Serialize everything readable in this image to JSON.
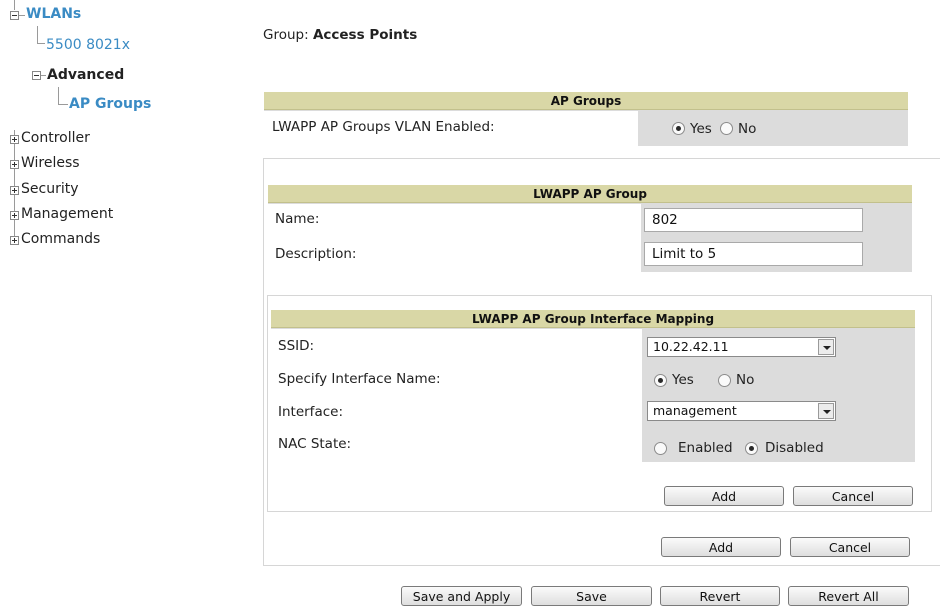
{
  "tree": {
    "wlans": "WLANs",
    "item_5500": "5500 8021x",
    "advanced": "Advanced",
    "ap_groups": "AP Groups",
    "controller": "Controller",
    "wireless": "Wireless",
    "security": "Security",
    "management": "Management",
    "commands": "Commands"
  },
  "group": {
    "prefix": "Group:",
    "name": "Access Points"
  },
  "ap_groups_box": {
    "header": "AP Groups",
    "label": "LWAPP AP Groups VLAN Enabled:",
    "yes": "Yes",
    "no": "No",
    "selected": "Yes"
  },
  "lwapp_group_box": {
    "header": "LWAPP AP Group",
    "name_label": "Name:",
    "name_value": "802",
    "description_label": "Description:",
    "description_value": "Limit to 5"
  },
  "mapping_box": {
    "header": "LWAPP AP Group Interface Mapping",
    "ssid_label": "SSID:",
    "ssid_value": "10.22.42.11",
    "specify_label": "Specify Interface Name:",
    "specify_yes": "Yes",
    "specify_no": "No",
    "specify_selected": "Yes",
    "interface_label": "Interface:",
    "interface_value": "management",
    "nac_label": "NAC State:",
    "nac_enabled": "Enabled",
    "nac_disabled": "Disabled",
    "nac_selected": "Disabled",
    "add": "Add",
    "cancel": "Cancel"
  },
  "group_actions": {
    "add": "Add",
    "cancel": "Cancel"
  },
  "footer": {
    "save_and_apply": "Save and Apply",
    "save": "Save",
    "revert": "Revert",
    "revert_all": "Revert All"
  }
}
